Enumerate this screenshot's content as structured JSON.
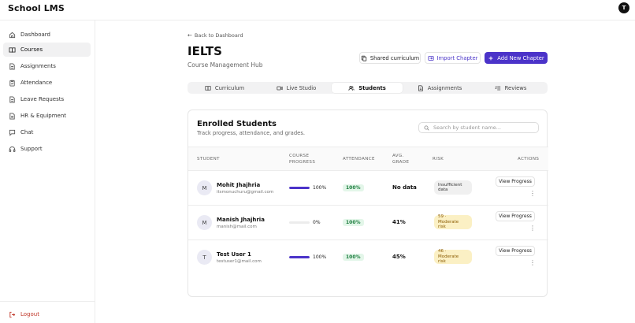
{
  "app": {
    "brand": "School LMS",
    "user_initial": "T"
  },
  "sidebar": {
    "items": [
      {
        "label": "Dashboard",
        "icon": "home-icon",
        "active": false
      },
      {
        "label": "Courses",
        "icon": "book-icon",
        "active": true
      },
      {
        "label": "Assignments",
        "icon": "document-icon",
        "active": false
      },
      {
        "label": "Attendance",
        "icon": "clipboard-icon",
        "active": false
      },
      {
        "label": "Leave Requests",
        "icon": "document-icon",
        "active": false
      },
      {
        "label": "HR & Equipment",
        "icon": "briefcase-icon",
        "active": false
      },
      {
        "label": "Chat",
        "icon": "chat-icon",
        "active": false
      },
      {
        "label": "Support",
        "icon": "headset-icon",
        "active": false
      }
    ],
    "logout": "Logout"
  },
  "header": {
    "back": "Back to Dashboard",
    "title": "IELTS",
    "subtitle": "Course Management Hub",
    "buttons": {
      "shared": "Shared curriculum",
      "import": "Import Chapter",
      "add": "Add New Chapter"
    }
  },
  "tabs": [
    {
      "label": "Curriculum",
      "icon": "book-open-icon"
    },
    {
      "label": "Live Studio",
      "icon": "video-icon"
    },
    {
      "label": "Students",
      "icon": "users-icon",
      "active": true
    },
    {
      "label": "Assignments",
      "icon": "document-icon"
    },
    {
      "label": "Reviews",
      "icon": "list-check-icon"
    }
  ],
  "students": {
    "title": "Enrolled Students",
    "subtitle": "Track progress, attendance, and grades.",
    "search_placeholder": "Search by student name...",
    "columns": {
      "student": "STUDENT",
      "course_progress_1": "COURSE",
      "course_progress_2": "PROGRESS",
      "attendance": "ATTENDANCE",
      "grade_1": "AVG.",
      "grade_2": "GRADE",
      "risk": "RISK",
      "actions": "ACTIONS"
    },
    "view_label": "View Progress",
    "rows": [
      {
        "initial": "M",
        "name": "Mohit Jhajhria",
        "email": "itsmonuchuru@gmail.com",
        "progress": 100,
        "progress_label": "100%",
        "attendance": "100%",
        "grade": "No data",
        "risk_1": "Insufficient",
        "risk_2": "data",
        "risk_color": "grey"
      },
      {
        "initial": "M",
        "name": "Manish Jhajhria",
        "email": "manish@mail.com",
        "progress": 0,
        "progress_label": "0%",
        "attendance": "100%",
        "grade": "41%",
        "risk_1": "59 · Moderate",
        "risk_2": "risk",
        "risk_color": "yellow"
      },
      {
        "initial": "T",
        "name": "Test User 1",
        "email": "testuser1@mail.com",
        "progress": 100,
        "progress_label": "100%",
        "attendance": "100%",
        "grade": "45%",
        "risk_1": "46 · Moderate",
        "risk_2": "risk",
        "risk_color": "yellow"
      }
    ]
  },
  "colors": {
    "accent": "#4b33c9",
    "danger": "#c0392b",
    "attendance_bg": "#e3f6e9",
    "risk_yellow": "#fbf0c4"
  }
}
